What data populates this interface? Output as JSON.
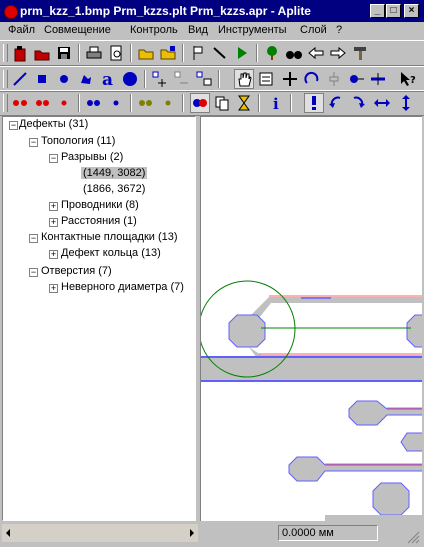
{
  "window": {
    "title": "prm_kzz_1.bmp    Prm_kzzs.plt    Prm_kzzs.apr - Aplite",
    "controls": [
      "_",
      "□",
      "×"
    ]
  },
  "menu": [
    "Файл",
    "Совмещение",
    "Контроль",
    "Вид",
    "Инструменты",
    "Слой",
    "?"
  ],
  "tree": {
    "root": "Дефекты (31)",
    "topology": "Топология (11)",
    "breaks": "Разрывы (2)",
    "break_1": "(1449, 3082)",
    "break_2": "(1866, 3672)",
    "conductors": "Проводники (8)",
    "distances": "Расстояния (1)",
    "pads": "Контактные площадки (13)",
    "ring_defect": "Дефект кольца (13)",
    "holes": "Отверстия (7)",
    "wrong_diameter": "Неверного диаметра (7)"
  },
  "status": {
    "coordinate": "0.0000 мм"
  },
  "colors": {
    "titlebar": "#000080",
    "pad": "#c0c0c0",
    "outline_red": "#ff6060",
    "outline_blue": "#6060ff",
    "circle": "#008000"
  }
}
